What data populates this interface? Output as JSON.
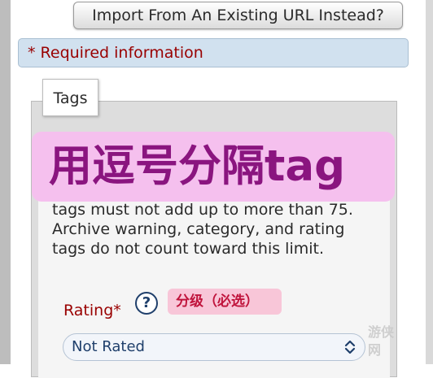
{
  "import_button": {
    "label": "Import From An Existing URL Instead?"
  },
  "required_notice": {
    "text": "* Required information"
  },
  "tags_section": {
    "legend": "Tags",
    "annotation_banner": "用逗号分隔tag",
    "help_text": "tags must not add up to more than 75.\nArchive warning, category, and rating\ntags do not count toward this limit."
  },
  "rating": {
    "label": "Rating*",
    "help_icon": "?",
    "annotation": "分级（必选）",
    "selected_value": "Not Rated"
  },
  "watermark": {
    "text": "游侠\n网"
  },
  "colors": {
    "required_red": "#990000",
    "notice_blue": "#d1e1ef",
    "banner_pink": "#f5c0ee",
    "banner_text_purple": "#8a157f",
    "annotation_pink": "#f8c6d8",
    "link_navy": "#1f3f6b"
  }
}
